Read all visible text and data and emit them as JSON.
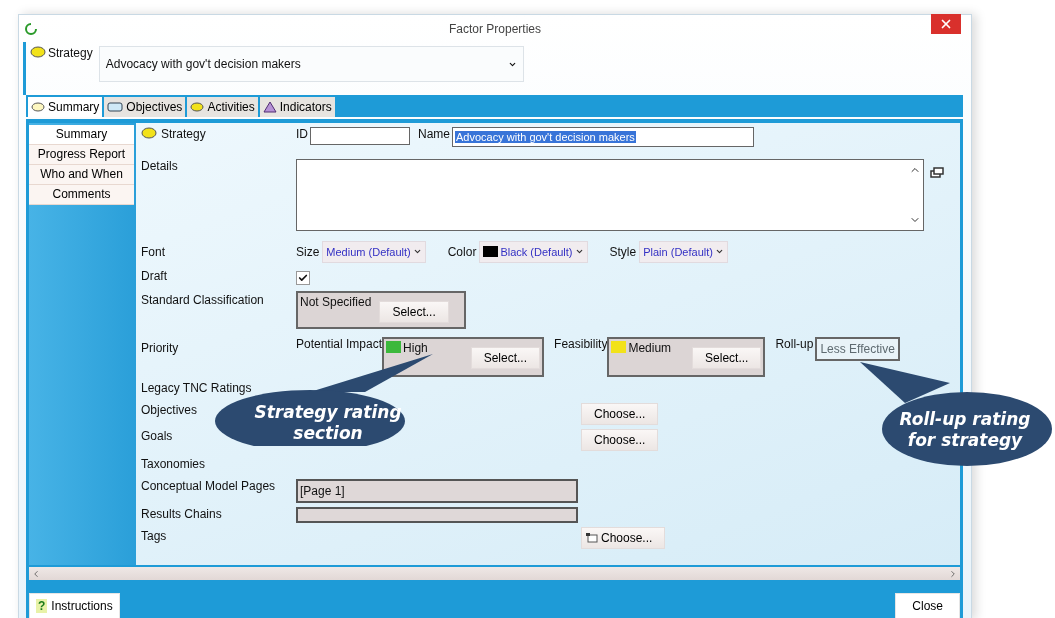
{
  "window": {
    "title": "Factor Properties"
  },
  "header": {
    "type_label": "Strategy",
    "value": "Advocacy with gov't decision makers"
  },
  "tabs": [
    {
      "label": "Summary",
      "kind": "strategy",
      "selected": true
    },
    {
      "label": "Objectives",
      "kind": "objective",
      "selected": false
    },
    {
      "label": "Activities",
      "kind": "activity",
      "selected": false
    },
    {
      "label": "Indicators",
      "kind": "indicator",
      "selected": false
    }
  ],
  "side_nav": [
    {
      "label": "Summary",
      "selected": true
    },
    {
      "label": "Progress Report",
      "selected": false
    },
    {
      "label": "Who and When",
      "selected": false
    },
    {
      "label": "Comments",
      "selected": false
    }
  ],
  "form": {
    "type_label": "Strategy",
    "id_label": "ID",
    "name_label": "Name",
    "name_value": "Advocacy with gov't decision makers",
    "details_label": "Details",
    "font": {
      "label": "Font",
      "selects": [
        {
          "label": "Size",
          "value": "Medium (Default)"
        },
        {
          "label": "Color",
          "value": "Black (Default)",
          "color": "#000000"
        },
        {
          "label": "Style",
          "value": "Plain (Default)"
        }
      ]
    },
    "draft": {
      "label": "Draft",
      "checked": true
    },
    "standard_classification": {
      "label": "Standard Classification",
      "value": "Not Specified",
      "button": "Select..."
    },
    "priority": {
      "label": "Priority",
      "ratings": [
        {
          "label": "Potential Impact",
          "value": "High",
          "color": "#3cb83c",
          "button": "Select..."
        },
        {
          "label": "Feasibility",
          "value": "Medium",
          "color": "#f2e21a",
          "button": "Select..."
        }
      ],
      "rollup": {
        "label": "Roll-up",
        "value": "Less Effective"
      }
    },
    "rows": [
      {
        "kind": "heading",
        "label": "Legacy TNC Ratings"
      },
      {
        "kind": "choose",
        "label": "Objectives",
        "button": "Choose..."
      },
      {
        "kind": "choose",
        "label": "Goals",
        "button": "Choose..."
      },
      {
        "kind": "heading",
        "label": "Taxonomies"
      },
      {
        "kind": "list",
        "label": "Conceptual Model Pages",
        "value": "[Page 1]"
      },
      {
        "kind": "list",
        "label": "Results Chains"
      },
      {
        "kind": "tags",
        "label": "Tags",
        "button": "Choose..."
      }
    ]
  },
  "footer": {
    "help_glyph": "?",
    "instructions": "Instructions",
    "close": "Close"
  },
  "callouts": [
    {
      "text": "Strategy rating section"
    },
    {
      "text": "Roll-up rating for strategy"
    }
  ]
}
